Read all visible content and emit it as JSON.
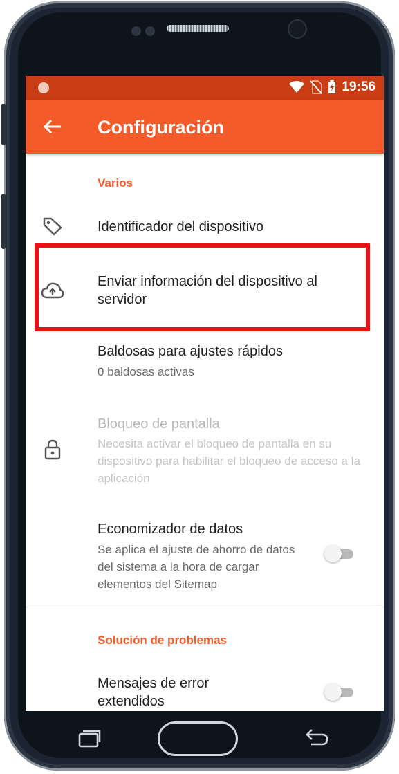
{
  "status_bar": {
    "time": "19:56"
  },
  "app_bar": {
    "title": "Configuración"
  },
  "sections": [
    {
      "header": "Varios",
      "items": [
        {
          "title": "Identificador del dispositivo",
          "icon": "tag-icon"
        },
        {
          "title": "Enviar información del dispositivo al servidor",
          "icon": "cloud-upload-icon"
        },
        {
          "title": "Baldosas para ajustes rápidos",
          "subtitle": "0 baldosas activas"
        },
        {
          "title": "Bloqueo de pantalla",
          "subtitle": "Necesita activar el bloqueo de pantalla en su dispositivo para habilitar el bloqueo de acceso a la aplicación",
          "icon": "lock-icon",
          "enabled": false
        },
        {
          "title": "Economizador de datos",
          "subtitle": "Se aplica el ajuste de ahorro de datos del sistema a la hora de cargar elementos del Sitemap",
          "toggle": false
        }
      ]
    },
    {
      "header": "Solución de problemas",
      "items": [
        {
          "title": "Mensajes de error extendidos",
          "toggle": false
        }
      ]
    }
  ],
  "colors": {
    "accent": "#f45b2a",
    "status_bar": "#c93d14",
    "highlight": "#ee1111"
  }
}
